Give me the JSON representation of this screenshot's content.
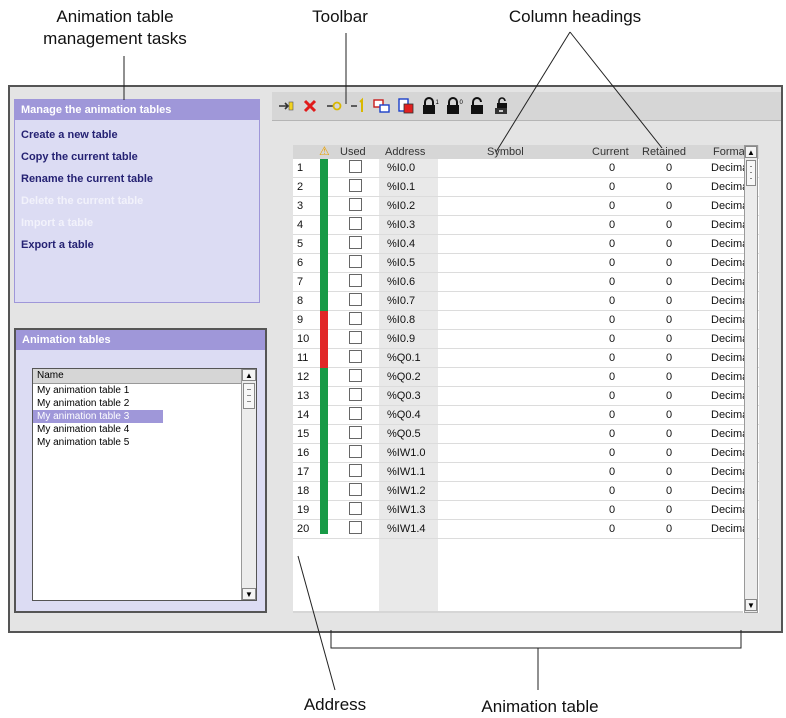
{
  "annotations": {
    "management_tasks": "Animation table\nmanagement tasks",
    "toolbar": "Toolbar",
    "column_headings": "Column headings",
    "address": "Address",
    "animation_table": "Animation table"
  },
  "tasks_panel": {
    "title": "Manage the animation tables",
    "items": [
      {
        "label": "Create a new table",
        "enabled": true
      },
      {
        "label": "Copy the current table",
        "enabled": true
      },
      {
        "label": "Rename the current table",
        "enabled": true
      },
      {
        "label": "Delete the current table",
        "enabled": false
      },
      {
        "label": "Import a table",
        "enabled": false
      },
      {
        "label": "Export a table",
        "enabled": true
      }
    ]
  },
  "tables_panel": {
    "title": "Animation tables",
    "column": "Name",
    "items": [
      "My animation table 1",
      "My animation table 2",
      "My animation table 3",
      "My animation table 4",
      "My animation table 5"
    ],
    "selected_index": 2
  },
  "toolbar": {
    "buttons": [
      "insert-row-icon",
      "delete-row-icon",
      "force-zero-icon",
      "force-one-icon",
      "copy-icon",
      "paste-icon",
      "lock-one-icon",
      "lock-zero-icon",
      "unlock-icon",
      "unlock-all-icon"
    ]
  },
  "table": {
    "headers": {
      "warning": "⚠",
      "used": "Used",
      "address": "Address",
      "symbol": "Symbol",
      "current": "Current",
      "retained": "Retained",
      "format": "Format"
    },
    "rows": [
      {
        "num": "1",
        "status": "green",
        "address": "%I0.0",
        "current": "0",
        "retained": "0",
        "format": "Decimal"
      },
      {
        "num": "2",
        "status": "green",
        "address": "%I0.1",
        "current": "0",
        "retained": "0",
        "format": "Decimal"
      },
      {
        "num": "3",
        "status": "green",
        "address": "%I0.2",
        "current": "0",
        "retained": "0",
        "format": "Decimal"
      },
      {
        "num": "4",
        "status": "green",
        "address": "%I0.3",
        "current": "0",
        "retained": "0",
        "format": "Decimal"
      },
      {
        "num": "5",
        "status": "green",
        "address": "%I0.4",
        "current": "0",
        "retained": "0",
        "format": "Decimal"
      },
      {
        "num": "6",
        "status": "green",
        "address": "%I0.5",
        "current": "0",
        "retained": "0",
        "format": "Decimal"
      },
      {
        "num": "7",
        "status": "green",
        "address": "%I0.6",
        "current": "0",
        "retained": "0",
        "format": "Decimal"
      },
      {
        "num": "8",
        "status": "green",
        "address": "%I0.7",
        "current": "0",
        "retained": "0",
        "format": "Decimal"
      },
      {
        "num": "9",
        "status": "red",
        "address": "%I0.8",
        "current": "0",
        "retained": "0",
        "format": "Decimal"
      },
      {
        "num": "10",
        "status": "red",
        "address": "%I0.9",
        "current": "0",
        "retained": "0",
        "format": "Decimal"
      },
      {
        "num": "11",
        "status": "red",
        "address": "%Q0.1",
        "current": "0",
        "retained": "0",
        "format": "Decimal"
      },
      {
        "num": "12",
        "status": "green",
        "address": "%Q0.2",
        "current": "0",
        "retained": "0",
        "format": "Decimal"
      },
      {
        "num": "13",
        "status": "green",
        "address": "%Q0.3",
        "current": "0",
        "retained": "0",
        "format": "Decimal"
      },
      {
        "num": "14",
        "status": "green",
        "address": "%Q0.4",
        "current": "0",
        "retained": "0",
        "format": "Decimal"
      },
      {
        "num": "15",
        "status": "green",
        "address": "%Q0.5",
        "current": "0",
        "retained": "0",
        "format": "Decimal"
      },
      {
        "num": "16",
        "status": "green",
        "address": "%IW1.0",
        "current": "0",
        "retained": "0",
        "format": "Decimal"
      },
      {
        "num": "17",
        "status": "green",
        "address": "%IW1.1",
        "current": "0",
        "retained": "0",
        "format": "Decimal"
      },
      {
        "num": "18",
        "status": "green",
        "address": "%IW1.2",
        "current": "0",
        "retained": "0",
        "format": "Decimal"
      },
      {
        "num": "19",
        "status": "green",
        "address": "%IW1.3",
        "current": "0",
        "retained": "0",
        "format": "Decimal"
      },
      {
        "num": "20",
        "status": "green",
        "address": "%IW1.4",
        "current": "0",
        "retained": "0",
        "format": "Decimal"
      }
    ]
  },
  "colors": {
    "green": "#179a46",
    "red": "#e12727",
    "accent": "#9f97d9"
  }
}
